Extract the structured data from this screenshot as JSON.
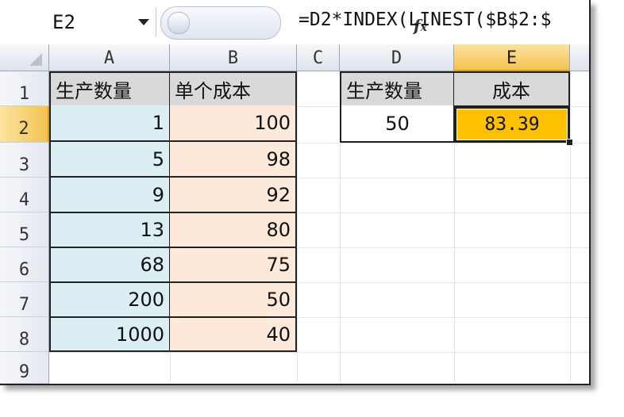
{
  "formula_bar": {
    "name_box": "E2",
    "fx_icon": "fx-icon",
    "formula": "=D2*INDEX(LINEST($B$2:$"
  },
  "columns": [
    "A",
    "B",
    "C",
    "D",
    "E"
  ],
  "rows": [
    "1",
    "2",
    "3",
    "4",
    "5",
    "6",
    "7",
    "8",
    "9"
  ],
  "table": {
    "header_qty": "生产数量",
    "header_unit_cost": "单个成本",
    "quantities": [
      "1",
      "5",
      "9",
      "13",
      "68",
      "200",
      "1000"
    ],
    "unit_costs": [
      "100",
      "98",
      "92",
      "80",
      "75",
      "50",
      "40"
    ]
  },
  "result": {
    "header_qty": "生产数量",
    "header_cost": "成本",
    "qty_value": "50",
    "cost_value": "83.39"
  },
  "colors": {
    "col_a_fill": "#daeef3",
    "col_b_fill": "#fde9d9",
    "header_fill": "#d9d9d9",
    "result_fill": "#ffc000",
    "selection_accent": "#f3c24f"
  }
}
